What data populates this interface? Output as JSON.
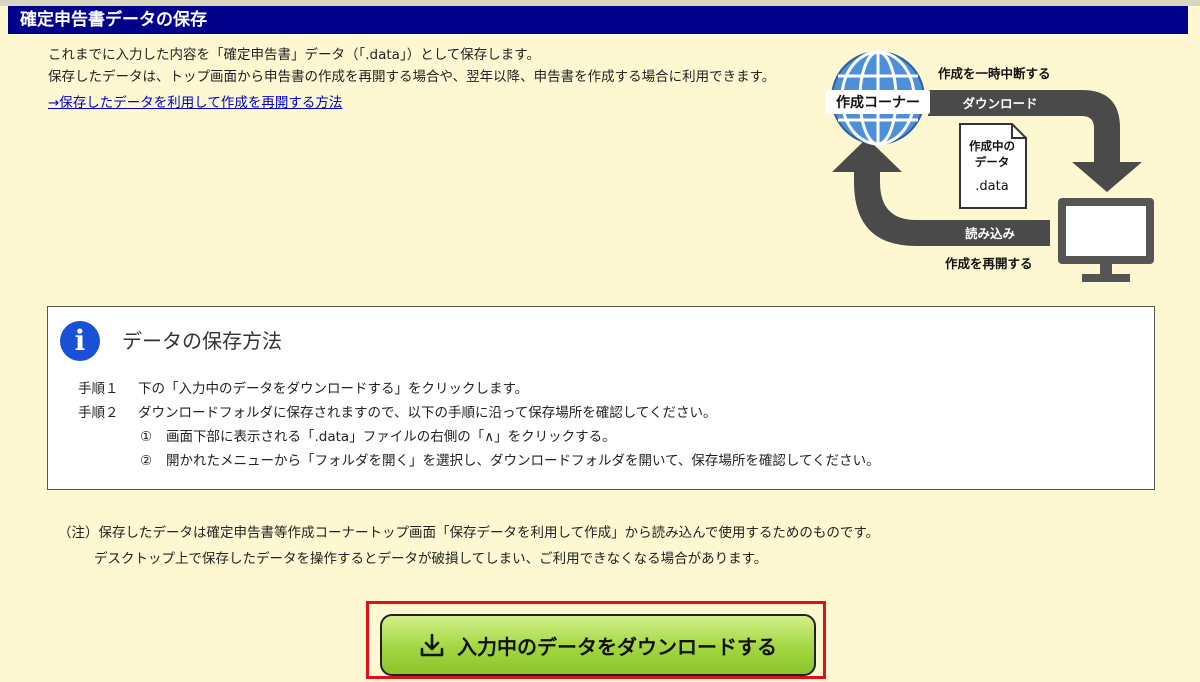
{
  "header": {
    "title": "確定申告書データの保存"
  },
  "intro": {
    "line1": "これまでに入力した内容を「確定申告書」データ（「.data」）として保存します。",
    "line2": "保存したデータは、トップ画面から申告書の作成を再開する場合や、翌年以降、申告書を作成する場合に利用できます。",
    "link": "→保存したデータを利用して作成を再開する方法"
  },
  "diagram": {
    "globe_label": "作成コーナー",
    "pause_label": "作成を一時中断する",
    "download_label": "ダウンロード",
    "file_line1": "作成中の",
    "file_line2": "データ",
    "file_ext": ".data",
    "load_label": "読み込み",
    "resume_label": "作成を再開する"
  },
  "info": {
    "icon": "i",
    "title": "データの保存方法",
    "step1_label": "手順１",
    "step1_text": "下の「入力中のデータをダウンロードする」をクリックします。",
    "step2_label": "手順２",
    "step2_text": "ダウンロードフォルダに保存されますので、以下の手順に沿って保存場所を確認してください。",
    "sub1_num": "①",
    "sub1_text": "画面下部に表示される「.data」ファイルの右側の「∧」をクリックする。",
    "sub2_num": "②",
    "sub2_text": "開かれたメニューから「フォルダを開く」を選択し、ダウンロードフォルダを開いて、保存場所を確認してください。"
  },
  "note": {
    "line1": "（注）保存したデータは確定申告書等作成コーナートップ画面「保存データを利用して作成」から読み込んで使用するためのものです。",
    "line2": "デスクトップ上で保存したデータを操作するとデータが破損してしまい、ご利用できなくなる場合があります。"
  },
  "download_button": {
    "label": "入力中のデータをダウンロードする"
  },
  "colors": {
    "header": "#00008b",
    "background": "#fdf8d2",
    "button": "#a2d640",
    "frame": "#e0101a",
    "globe": "#4d8fd8"
  }
}
